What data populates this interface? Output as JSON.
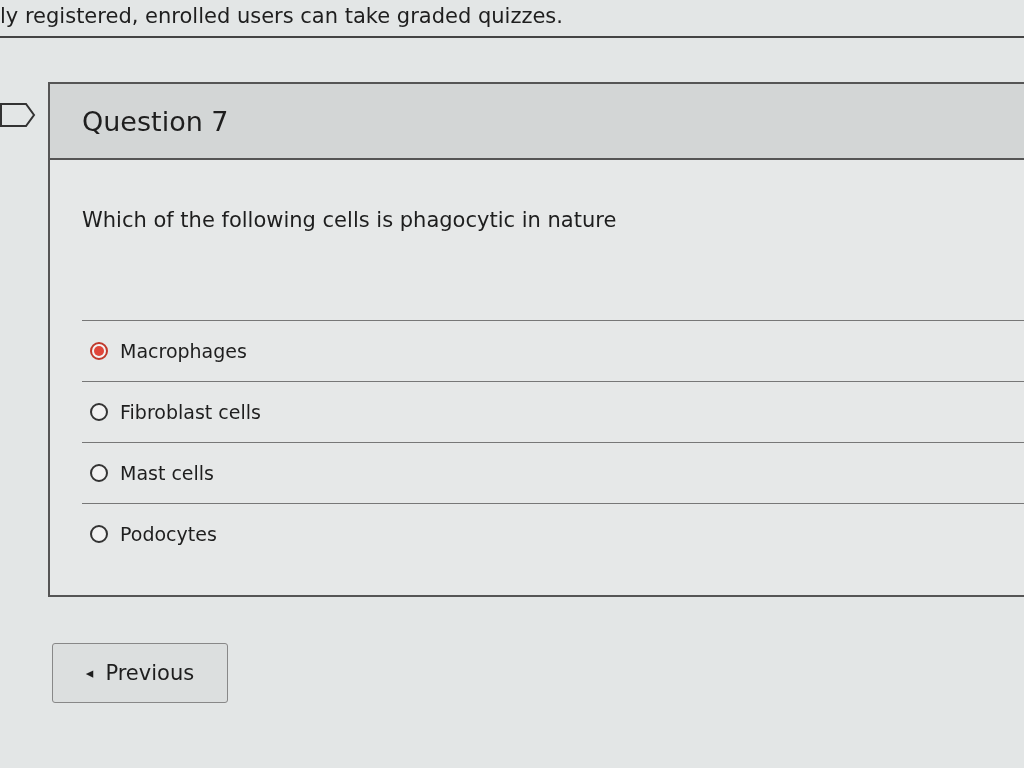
{
  "notice": "ly registered, enrolled users can take graded quizzes.",
  "question": {
    "title": "Question 7",
    "flagged": false,
    "prompt": "Which of the following cells is phagocytic in nature",
    "answers": [
      {
        "label": "Macrophages",
        "selected": true
      },
      {
        "label": "Fibroblast cells",
        "selected": false
      },
      {
        "label": "Mast cells",
        "selected": false
      },
      {
        "label": "Podocytes",
        "selected": false
      }
    ]
  },
  "buttons": [
    {
      "label": "Previous",
      "icon": "◂"
    }
  ]
}
